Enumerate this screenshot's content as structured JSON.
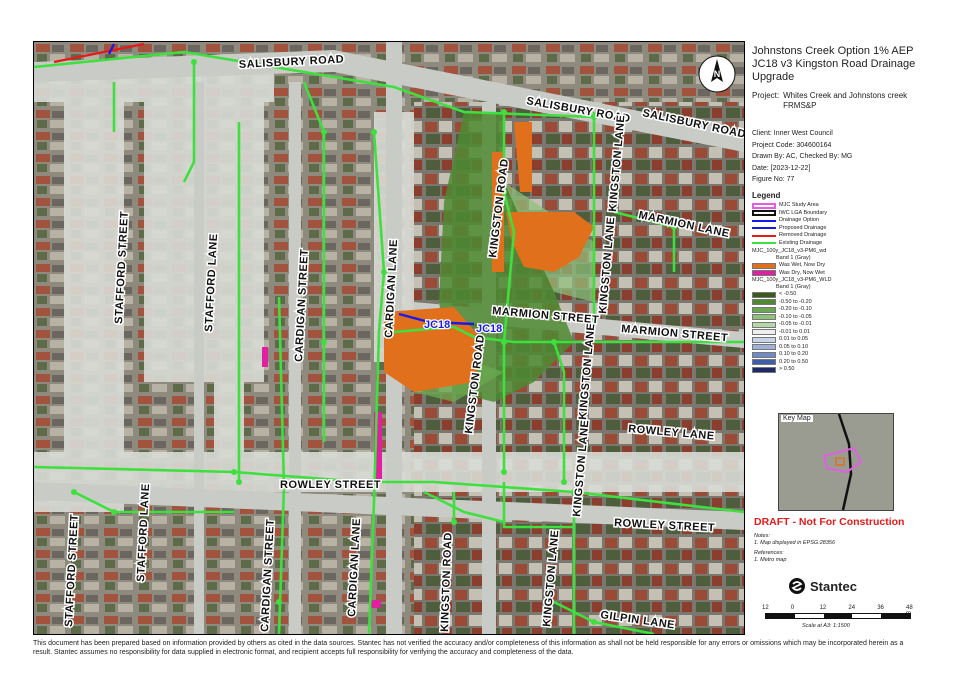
{
  "map": {
    "streets": {
      "salisbury_road_w": "SALISBURY ROAD",
      "salisbury_road_c": "SALISBURY ROAD",
      "salisbury_road_e": "SALISBURY ROAD",
      "stafford_street_n": "STAFFORD STREET",
      "stafford_street_s": "STAFFORD STREET",
      "stafford_lane_n": "STAFFORD LANE",
      "stafford_lane_s": "STAFFORD LANE",
      "cardigan_street_n": "CARDIGAN STREET",
      "cardigan_street_s": "CARDIGAN STREET",
      "cardigan_lane_n": "CARDIGAN LANE",
      "cardigan_lane_s": "CARDIGAN LANE",
      "kingston_road_n": "KINGSTON ROAD",
      "kingston_road_c": "KINGSTON ROAD",
      "kingston_road_s": "KINGSTON ROAD",
      "kingston_lane_n1": "KINGSTON LANE",
      "kingston_lane_n2": "KINGSTON LANE",
      "kingston_lane_c": "KINGSTON LANE",
      "kingston_lane_s": "KINGSTON LANE",
      "kingston_lane_s2": "KINGSTON LANE",
      "marmion_lane": "MARMION LANE",
      "marmion_street_w": "MARMION STREET",
      "marmion_street_e": "MARMION STREET",
      "rowley_lane": "ROWLEY LANE",
      "rowley_street_w": "ROWLEY STREET",
      "rowley_street_e": "ROWLEY STREET",
      "gilpin_lane": "GILPIN LANE"
    },
    "markers": [
      "JC18",
      "JC18"
    ],
    "north_arrow": "N",
    "north_icon": "north-arrow-icon",
    "colors": {
      "existing_drainage": "#3de03d",
      "drainage_option": "#1a1ae6",
      "removed_drainage": "#e61a1a",
      "was_wet_now_dry": "#e0701c",
      "was_dry_now_wet": "#e020a0",
      "study_area": "#e060e0"
    }
  },
  "panel": {
    "title": "Johnstons Creek Option 1% AEP\nJC18 v3 Kingston Road Drainage\nUpgrade",
    "project_label": "Project:",
    "project_value": "Whites Creek and Johnstons creek FRMS&P",
    "client": "Client:  Inner West Council",
    "project_code": "Project Code:  304600164",
    "drawn_by": "Drawn By:  AC, Checked By: MG",
    "date": "Date:  [2023-12-22]",
    "figure_no": "Figure No:  77",
    "legend_title": "Legend",
    "legend_lines": [
      {
        "label": "MJC Study Area",
        "color": "#e060e0",
        "kind": "box"
      },
      {
        "label": "IWC LGA Boundary",
        "color": "#111111",
        "kind": "box"
      },
      {
        "label": "Drainage Option",
        "color": "#1a1ae6",
        "kind": "line"
      },
      {
        "label": "Proposed Drainage",
        "color": "#1a1ae6",
        "kind": "line"
      },
      {
        "label": "Removed Drainage",
        "color": "#e61a1a",
        "kind": "line"
      },
      {
        "label": "Existing Drainage",
        "color": "#3de03d",
        "kind": "line"
      }
    ],
    "wd_layer": "MJC_100y_JC18_v3-PM6_wd",
    "wd_band": "Band 1 (Gray)",
    "wd_items": [
      {
        "label": "Was Wet, Now Dry",
        "color": "#e0701c"
      },
      {
        "label": "Was Dry, Now Wet",
        "color": "#e020a0"
      }
    ],
    "wld_layer": "MJC_100y_JC18_v3-PM6_WLD",
    "wld_band": "Band 1 (Gray)",
    "wld_items": [
      {
        "label": "< -0.50",
        "color": "#3c5a1e"
      },
      {
        "label": "-0.50 to -0.20",
        "color": "#4f8a32"
      },
      {
        "label": "-0.20 to -0.10",
        "color": "#6aa84f"
      },
      {
        "label": "-0.10 to -0.05",
        "color": "#8ec27a"
      },
      {
        "label": "-0.05 to -0.01",
        "color": "#b7d8a8"
      },
      {
        "label": "-0.01 to 0.01",
        "color": "#eeeeee"
      },
      {
        "label": "0.01 to 0.05",
        "color": "#c9d4e8"
      },
      {
        "label": "0.05 to 0.10",
        "color": "#9fb3d9"
      },
      {
        "label": "0.10 to 0.20",
        "color": "#6f8cc4"
      },
      {
        "label": "0.20 to 0.50",
        "color": "#3f5ea8"
      },
      {
        "label": "> 0.50",
        "color": "#1e2a66"
      }
    ],
    "key_map_title": "Key Map",
    "draft": "DRAFT - Not For Construction",
    "notes_title": "Notes:",
    "notes_text": "1. Map displayed in EPSG:28356",
    "refs_title": "References:",
    "refs_text": "1. Metro map",
    "logo_text": "Stantec",
    "scale_ticks": [
      "12",
      "0",
      "12",
      "24",
      "36",
      "48 m"
    ],
    "scale_text": "Scale at A3: 1:1500"
  },
  "disclaimer": "This document has been prepared based on information provided by others as cited in the data sources. Stantec has not verified the accuracy and/or completeness of this information as shall not be held responsible for any errors or omissions which may be incorporated herein as a result. Stantec assumes no responsibility for data supplied in electronic format, and recipient accepts full responsibility for verifying the accuracy and completeness of the data."
}
